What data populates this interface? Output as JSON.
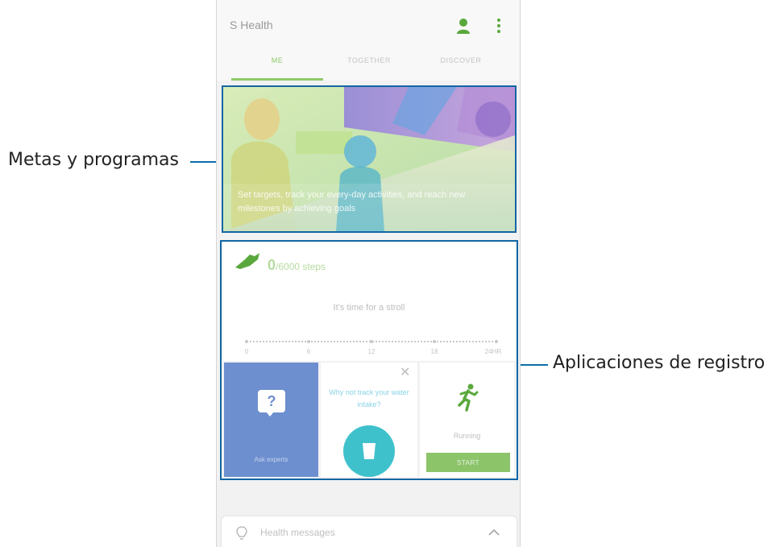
{
  "annotations": {
    "goals_label": "Metas y programas",
    "trackers_label": "Aplicaciones de registro"
  },
  "app": {
    "title": "S Health",
    "icons": [
      "profile-icon",
      "more-options-icon"
    ]
  },
  "tabs": [
    {
      "label": "ME",
      "active": true
    },
    {
      "label": "TOGETHER",
      "active": false
    },
    {
      "label": "DISCOVER",
      "active": false
    }
  ],
  "banner": {
    "text": "Set targets, track your every-day activities, and reach new milestones by achieving goals"
  },
  "steps": {
    "value": "0",
    "label": "/6000 steps",
    "message": "It's time for a stroll",
    "timeline": [
      "0",
      "6",
      "12",
      "18",
      "24HR"
    ]
  },
  "trackers": {
    "ask": {
      "label": "Ask experts",
      "icon": "question-bubble-icon"
    },
    "water": {
      "text": "Why not track your water intake?",
      "icon": "water-cup-icon"
    },
    "running": {
      "label": "Running",
      "button": "START",
      "icon": "running-person-icon"
    }
  },
  "messages": {
    "label": "Health messages",
    "icon": "lightbulb-icon"
  },
  "colors": {
    "accent_green": "#8cc46a",
    "annotation_blue": "#1266a3",
    "ask_blue": "#6d8fcf",
    "water_teal": "#3fc1cc"
  }
}
